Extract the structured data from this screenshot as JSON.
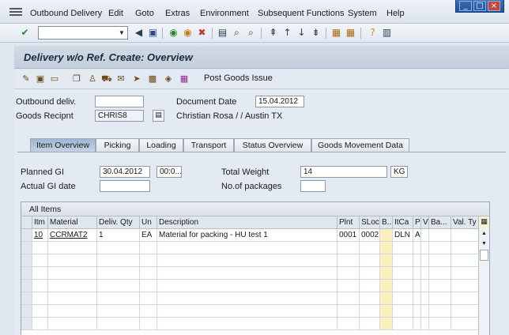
{
  "menu": [
    "Outbound Delivery",
    "Edit",
    "Goto",
    "Extras",
    "Environment",
    "Subsequent Functions",
    "System",
    "Help"
  ],
  "window_controls": {
    "minimize": "_",
    "maximize": "□",
    "close": "×"
  },
  "title": "Delivery w/o Ref. Create: Overview",
  "app_toolbar": {
    "post_goods_issue": "Post Goods Issue"
  },
  "header": {
    "outbound_deliv_label": "Outbound deliv.",
    "outbound_deliv_value": "",
    "goods_recipient_label": "Goods Recipnt",
    "goods_recipient_value": "CHRIS8",
    "goods_recipient_name": "Christian Rosa / / Austin TX",
    "document_date_label": "Document Date",
    "document_date_value": "15.04.2012"
  },
  "tabs": [
    "Item Overview",
    "Picking",
    "Loading",
    "Transport",
    "Status Overview",
    "Goods Movement Data"
  ],
  "item_overview": {
    "planned_gi_label": "Planned GI",
    "planned_gi_date": "30.04.2012",
    "planned_gi_time": "00:0...",
    "actual_gi_label": "Actual GI date",
    "actual_gi_value": "",
    "total_weight_label": "Total Weight",
    "total_weight_value": "14",
    "weight_unit": "KG",
    "packages_label": "No.of packages",
    "packages_value": ""
  },
  "table": {
    "title": "All Items",
    "columns": [
      "Itm",
      "Material",
      "Deliv. Qty",
      "Un",
      "Description",
      "Plnt",
      "SLoc",
      "B...",
      "ItCa",
      "P",
      "V",
      "Ba...",
      "Val. Ty"
    ],
    "rows": [
      {
        "itm": "10",
        "material": "CCRMAT2",
        "qty": "1",
        "un": "EA",
        "description": "Material for packing - HU test 1",
        "plnt": "0001",
        "sloc": "0002",
        "b": "",
        "itca": "DLN",
        "p": "A",
        "v": "",
        "ba": "",
        "valty": ""
      }
    ]
  }
}
